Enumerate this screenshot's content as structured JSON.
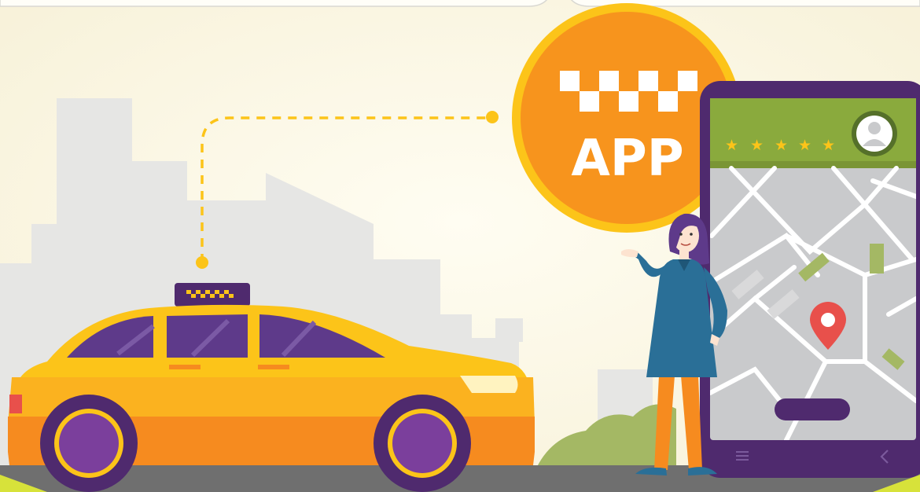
{
  "badge": {
    "label": "APP"
  },
  "phone": {
    "rating_stars": 5,
    "rating_glyph": "★"
  },
  "icons": {
    "taxi-checker": "checkered-flag",
    "profile": "user-avatar-icon",
    "map-pin": "location-pin-icon",
    "nav-menu": "menu-icon",
    "nav-back": "back-chevron-icon"
  },
  "colors": {
    "background": "#fdf9e8",
    "taxi_yellow": "#fbb21f",
    "taxi_orange": "#f68b1f",
    "accent_purple": "#4f2a6e",
    "badge_orange": "#f7941d",
    "badge_ring": "#fcc419",
    "phone_header_green": "#8aaa3d",
    "map_gray": "#c9cacc",
    "pin_red": "#e8504b",
    "person_teal": "#2a6f97"
  }
}
